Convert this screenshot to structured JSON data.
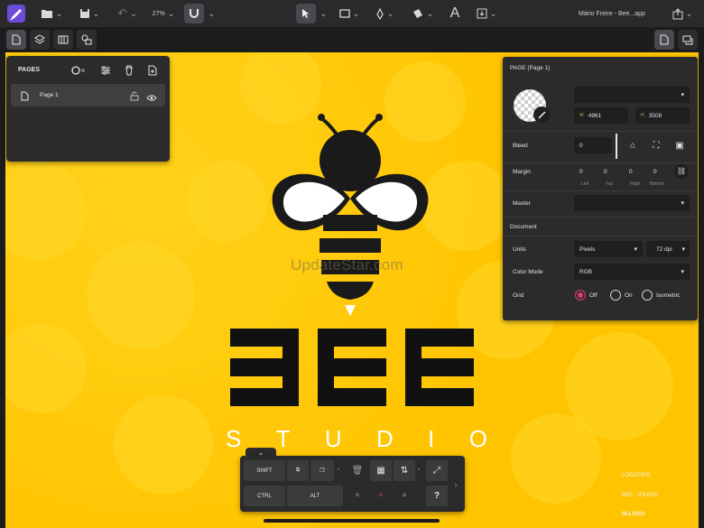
{
  "topbar": {
    "zoom": "27%",
    "file_name": "Mário Freire - Bee...app"
  },
  "pages_panel": {
    "title": "PAGES",
    "pages": [
      {
        "label": "Page 1"
      }
    ]
  },
  "document_panel": {
    "title": "PAGE (Page 1)",
    "width": "4961",
    "height": "3508",
    "width_prefix": "W",
    "height_prefix": "H",
    "bleed_label": "Bleed",
    "bleed_value": "0",
    "margin_label": "Margin",
    "margin_values": [
      "0",
      "0",
      "0",
      "0"
    ],
    "margin_sides": [
      "Left",
      "Top",
      "Right",
      "Bottom"
    ],
    "master_label": "Master",
    "section_label": "Document",
    "units_label": "Units",
    "units_value": "Pixels",
    "dpi_value": "72 dpi",
    "color_mode_label": "Color Mode",
    "color_mode_value": "RGB",
    "grid_label": "Grid",
    "grid_options": [
      "Off",
      "On",
      "Isometric"
    ],
    "grid_selected": "Off"
  },
  "artwork": {
    "brand_name": "BEE",
    "subtitle_letters": [
      "S",
      "T",
      "U",
      "D",
      "I",
      "O"
    ],
    "watermark": "UpdateStar.com"
  },
  "shortcut_bar": {
    "shift": "SHIFT",
    "ctrl": "CTRL",
    "alt": "ALT",
    "help": "?"
  },
  "credits": {
    "line1": "LOGOTIPO",
    "line2": "BEE - STUDIO",
    "line3": "IN.LOGO"
  },
  "colors": {
    "canvas": "#ffc400",
    "accent_radio": "#d93a73",
    "app_purple": "#6b4bd8"
  }
}
